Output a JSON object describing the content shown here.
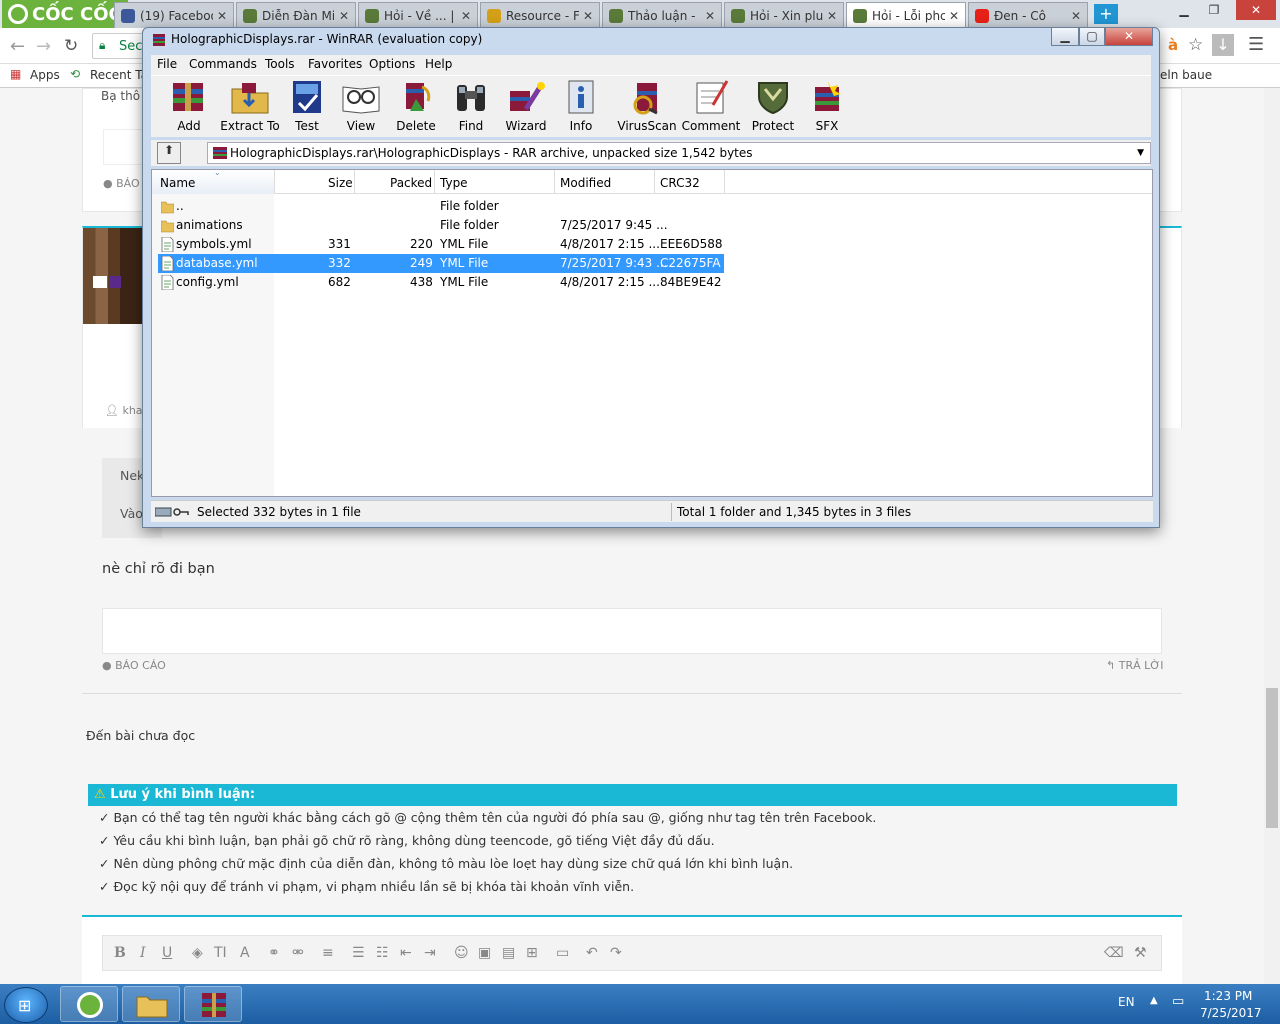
{
  "browser": {
    "brand": "CỐC CỐC",
    "tabs": [
      {
        "label": "(19) Faceboo",
        "color": "#3b5998"
      },
      {
        "label": "Diễn Đàn Mi",
        "color": "#5a7a3a"
      },
      {
        "label": "Hỏi - Về ... | ",
        "color": "#5a7a3a"
      },
      {
        "label": "Resource - F",
        "color": "#d4a017"
      },
      {
        "label": "Thảo luận - ",
        "color": "#5a7a3a"
      },
      {
        "label": "Hỏi - Xin plu",
        "color": "#5a7a3a"
      },
      {
        "label": "Hỏi - Lỗi phc",
        "color": "#5a7a3a"
      },
      {
        "label": "Đen - Cô",
        "color": "#e62117"
      }
    ],
    "address_partial": "Sec",
    "bookmarks": {
      "apps": "Apps",
      "recent": "Recent Ta",
      "right": "eln baue"
    }
  },
  "forum": {
    "post_text_partial": "Bạ thô",
    "report1": "BÁO C",
    "author_partial": "kha",
    "quote_partial_1": "Nek",
    "quote_partial_2": "Vào",
    "reply_text": "nè chỉ rõ đi bạn",
    "report2": "BÁO CÁO",
    "reply_link": "TRẢ LỜI",
    "unread_link": "Đến bài chưa đọc",
    "notice_title": "Lưu ý khi bình luận:",
    "rules": [
      "✓ Bạn có thể tag tên người khác bằng cách gõ @ cộng thêm tên của người đó phía sau @, giống như tag tên trên Facebook.",
      "✓ Yêu cầu khi bình luận, bạn phải gõ chữ rõ ràng, không dùng teencode, gõ tiếng Việt đầy đủ dấu.",
      "✓ Nên dùng phông chữ mặc định của diễn đàn, không tô màu lòe loẹt hay dùng size chữ quá lớn khi bình luận.",
      "✓ Đọc kỹ nội quy để tránh vi phạm, vi phạm nhiều lần sẽ bị khóa tài khoản vĩnh viễn."
    ]
  },
  "winrar": {
    "title": "HolographicDisplays.rar - WinRAR (evaluation copy)",
    "menu": [
      "File",
      "Commands",
      "Tools",
      "Favorites",
      "Options",
      "Help"
    ],
    "tools": [
      "Add",
      "Extract To",
      "Test",
      "View",
      "Delete",
      "Find",
      "Wizard",
      "Info",
      "VirusScan",
      "Comment",
      "Protect",
      "SFX"
    ],
    "path": "HolographicDisplays.rar\\HolographicDisplays - RAR archive, unpacked size 1,542 bytes",
    "columns": [
      "Name",
      "Size",
      "Packed",
      "Type",
      "Modified",
      "CRC32"
    ],
    "files": [
      {
        "name": "..",
        "size": "",
        "packed": "",
        "type": "File folder",
        "modified": "",
        "crc": "",
        "kind": "folder"
      },
      {
        "name": "animations",
        "size": "",
        "packed": "",
        "type": "File folder",
        "modified": "7/25/2017 9:45 ...",
        "crc": "",
        "kind": "folder"
      },
      {
        "name": "symbols.yml",
        "size": "331",
        "packed": "220",
        "type": "YML File",
        "modified": "4/8/2017 2:15 ...",
        "crc": "EEE6D588",
        "kind": "file"
      },
      {
        "name": "database.yml",
        "size": "332",
        "packed": "249",
        "type": "YML File",
        "modified": "7/25/2017 9:43 ...",
        "crc": "C22675FA",
        "kind": "file"
      },
      {
        "name": "config.yml",
        "size": "682",
        "packed": "438",
        "type": "YML File",
        "modified": "4/8/2017 2:15 ...",
        "crc": "84BE9E42",
        "kind": "file"
      }
    ],
    "selected_row": 3,
    "status_left": "Selected 332 bytes in 1 file",
    "status_right": "Total 1 folder and 1,345 bytes in 3 files"
  },
  "taskbar": {
    "lang": "EN",
    "time": "1:23 PM",
    "date": "7/25/2017"
  }
}
